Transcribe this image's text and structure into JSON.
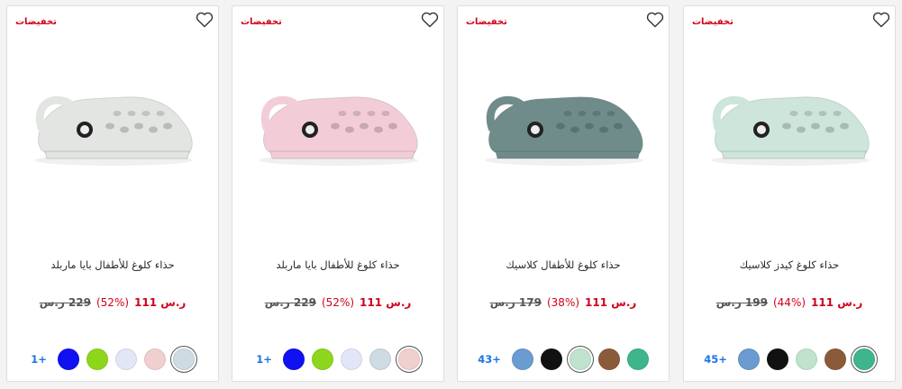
{
  "products": [
    {
      "badge": "تخفيضات",
      "title": "حذاء كلوغ كيدز كلاسيك",
      "price_now": "ر.س 111",
      "discount": "(44%)",
      "price_was": "199 ر.س",
      "body_color": "#cde5da",
      "swatches": [
        {
          "color": "#3fb58c",
          "selected": true
        },
        {
          "color": "#8a5a3b",
          "selected": false
        },
        {
          "color": "#bfe3cc",
          "selected": false
        },
        {
          "color": "#111111",
          "selected": false
        },
        {
          "color": "#6a9bd1",
          "selected": false
        }
      ],
      "more": "45+"
    },
    {
      "badge": "تخفيضات",
      "title": "حذاء كلوغ للأطفال كلاسيك",
      "price_now": "ر.س 111",
      "discount": "(38%)",
      "price_was": "179 ر.س",
      "body_color": "#6f8c8a",
      "swatches": [
        {
          "color": "#3fb58c",
          "selected": false
        },
        {
          "color": "#8a5a3b",
          "selected": false
        },
        {
          "color": "#bfe3cc",
          "selected": true
        },
        {
          "color": "#111111",
          "selected": false
        },
        {
          "color": "#6a9bd1",
          "selected": false
        }
      ],
      "more": "43+"
    },
    {
      "badge": "تخفيضات",
      "title": "حذاء كلوغ للأطفال بايا ماربلد",
      "price_now": "ر.س 111",
      "discount": "(52%)",
      "price_was": "229 ر.س",
      "body_color": "#f2cdd8",
      "swatches": [
        {
          "color": "#f2cfcf",
          "selected": true
        },
        {
          "color": "#cfdbe3",
          "selected": false
        },
        {
          "color": "#e2e6f7",
          "selected": false
        },
        {
          "color": "#8ed61c",
          "selected": false
        },
        {
          "color": "#1010f0",
          "selected": false
        }
      ],
      "more": "1+"
    },
    {
      "badge": "تخفيضات",
      "title": "حذاء كلوغ للأطفال بايا ماربلد",
      "price_now": "ر.س 111",
      "discount": "(52%)",
      "price_was": "229 ر.س",
      "body_color": "#e3e5e2",
      "swatches": [
        {
          "color": "#cfdbe3",
          "selected": true
        },
        {
          "color": "#f2cfcf",
          "selected": false
        },
        {
          "color": "#e2e6f7",
          "selected": false
        },
        {
          "color": "#8ed61c",
          "selected": false
        },
        {
          "color": "#1010f0",
          "selected": false
        }
      ],
      "more": "1+"
    }
  ]
}
